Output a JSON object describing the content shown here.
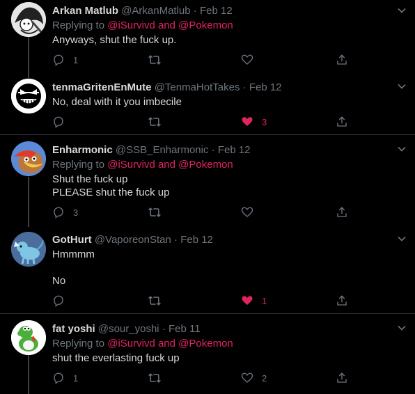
{
  "colors": {
    "background": "#000000",
    "text": "#d9d9d9",
    "muted": "#6e767d",
    "accent": "#e0245e",
    "divider": "#2f3336"
  },
  "tweets": [
    {
      "name": "Arkan Matlub",
      "handle": "@ArkanMatlub",
      "dot": "·",
      "date": "Feb 12",
      "replying_prefix": "Replying to",
      "mention1": "@iSurvivd",
      "and": "and",
      "mention2": "@Pokemon",
      "lines": [
        "Anyways, shut the fuck up."
      ],
      "reply_count": "1",
      "retweet_count": "",
      "like_count": "",
      "liked": false,
      "avatar_icon": "manga-avatar"
    },
    {
      "name": "tenmaGritenEnMute",
      "handle": "@TenmaHotTakes",
      "dot": "·",
      "date": "Feb 12",
      "lines": [
        "No, deal with it you imbecile"
      ],
      "reply_count": "",
      "retweet_count": "",
      "like_count": "3",
      "liked": true,
      "avatar_icon": "grin-face-avatar"
    },
    {
      "name": "Enharmonic",
      "handle": "@SSB_Enharmonic",
      "dot": "·",
      "date": "Feb 12",
      "replying_prefix": "Replying to",
      "mention1": "@iSurvivd",
      "and": "and",
      "mention2": "@Pokemon",
      "lines": [
        "Shut the fuck up",
        "PLEASE shut the fuck up"
      ],
      "reply_count": "3",
      "retweet_count": "",
      "like_count": "",
      "liked": false,
      "avatar_icon": "bear-bird-avatar"
    },
    {
      "name": "GotHurt",
      "handle": "@VaporeonStan",
      "dot": "·",
      "date": "Feb 12",
      "lines": [
        "Hmmmm",
        "No"
      ],
      "reply_count": "",
      "retweet_count": "",
      "like_count": "1",
      "liked": true,
      "avatar_icon": "vaporeon-avatar"
    },
    {
      "name": "fat yoshi",
      "handle": "@sour_yoshi",
      "dot": "·",
      "date": "Feb 11",
      "replying_prefix": "Replying to",
      "mention1": "@iSurvivd",
      "and": "and",
      "mention2": "@Pokemon",
      "lines": [
        "shut the everlasting fuck up"
      ],
      "reply_count": "1",
      "retweet_count": "",
      "like_count": "2",
      "liked": false,
      "avatar_icon": "yoshi-avatar"
    }
  ]
}
